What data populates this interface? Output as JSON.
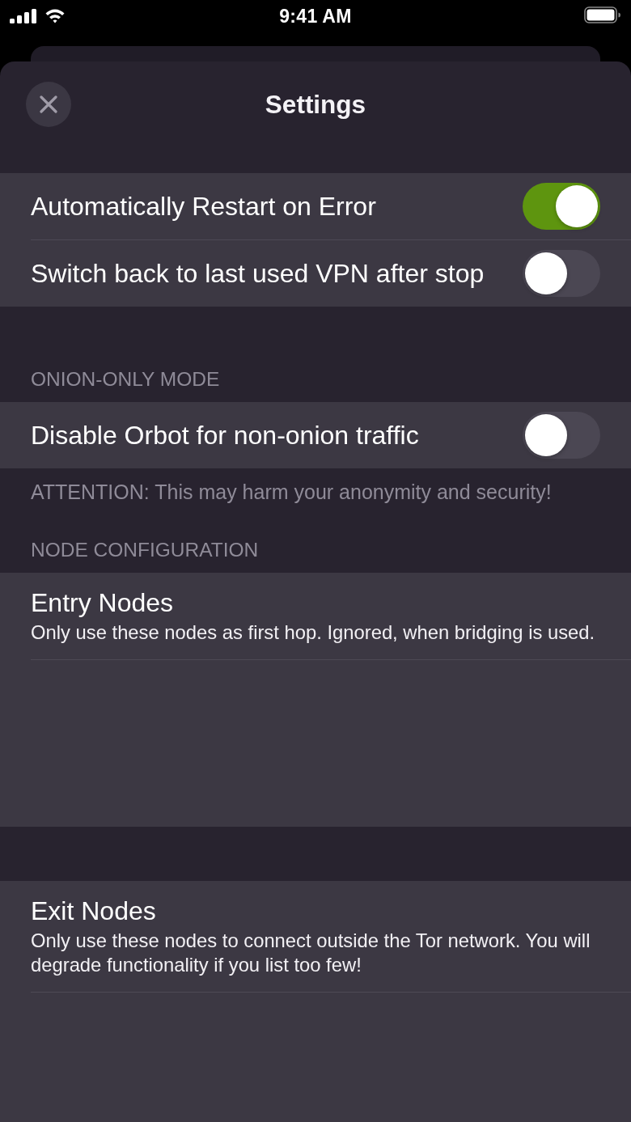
{
  "status_bar": {
    "time": "9:41 AM"
  },
  "header": {
    "title": "Settings"
  },
  "sections": [
    {
      "rows": [
        {
          "kind": "toggle",
          "label": "Automatically Restart on Error",
          "on": true
        },
        {
          "kind": "toggle",
          "label": "Switch back to last used VPN after stop",
          "on": false
        }
      ]
    },
    {
      "header": "ONION-ONLY MODE",
      "rows": [
        {
          "kind": "toggle",
          "label": "Disable Orbot for non-onion traffic",
          "on": false
        }
      ],
      "footer": "ATTENTION: This may harm your anonymity and security!"
    },
    {
      "header": "NODE CONFIGURATION",
      "rows": [
        {
          "kind": "text_area",
          "title": "Entry Nodes",
          "subtitle": "Only use these nodes as first hop. Ignored, when bridging is used."
        }
      ]
    },
    {
      "rows": [
        {
          "kind": "text_area",
          "title": "Exit Nodes",
          "subtitle": "Only use these nodes to connect outside the Tor network. You will degrade functionality if you list too few!"
        }
      ]
    }
  ]
}
